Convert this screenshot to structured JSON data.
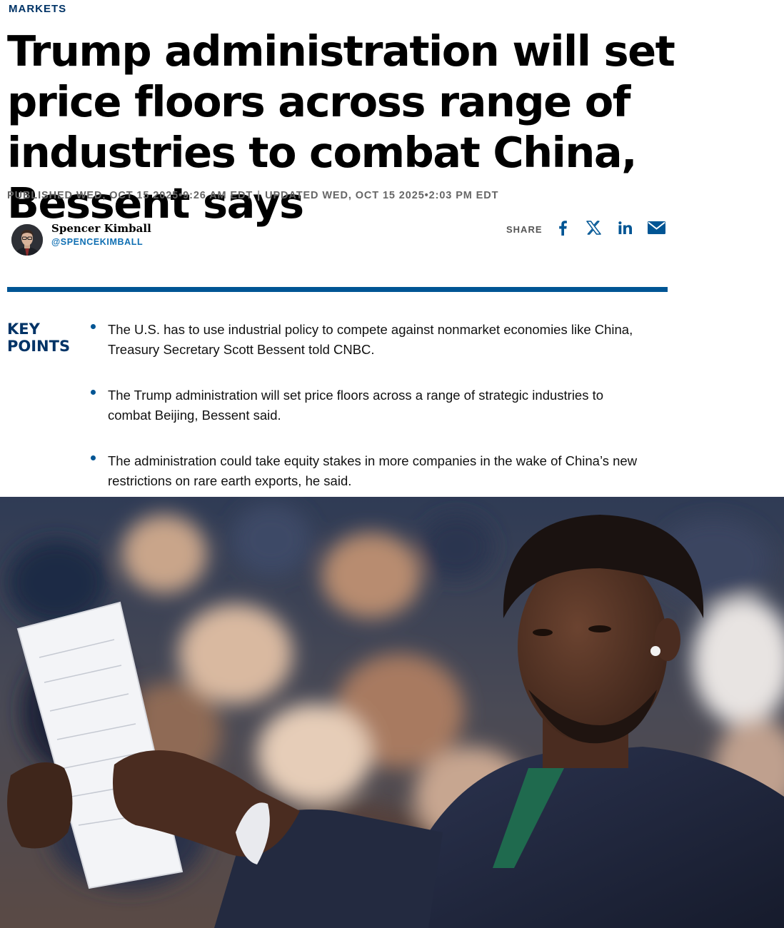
{
  "section": {
    "label": "MARKETS"
  },
  "article": {
    "headline": "Trump administration will set price floors across range of industries to combat China, Bessent says",
    "published": "PUBLISHED WED, OCT 15 2025•9:26 AM EDT",
    "separator": "|",
    "updated": "UPDATED WED, OCT 15 2025•2:03 PM EDT"
  },
  "author": {
    "name": "Spencer Kimball",
    "handle": "@SPENCEKIMBALL"
  },
  "share": {
    "label": "SHARE",
    "buttons": [
      {
        "name": "facebook",
        "icon": "facebook-icon"
      },
      {
        "name": "x",
        "icon": "x-icon"
      },
      {
        "name": "linkedin",
        "icon": "linkedin-icon"
      },
      {
        "name": "email",
        "icon": "email-icon"
      }
    ]
  },
  "key_points": {
    "title_line1": "KEY",
    "title_line2": "POINTS",
    "items": [
      "The U.S. has to use industrial policy to compete against nonmarket economies like China, Treasury Secretary Scott Bessent told CNBC.",
      "The Trump administration will set price floors across a range of strategic industries to combat Beijing, Bessent said.",
      "The administration could take equity stakes in more companies in the wake of China’s new restrictions on rare earth exports, he said."
    ]
  },
  "colors": {
    "brand_blue": "#005594",
    "dark_navy": "#003366",
    "link_blue": "#0f6fb3",
    "meta_gray": "#666666"
  }
}
